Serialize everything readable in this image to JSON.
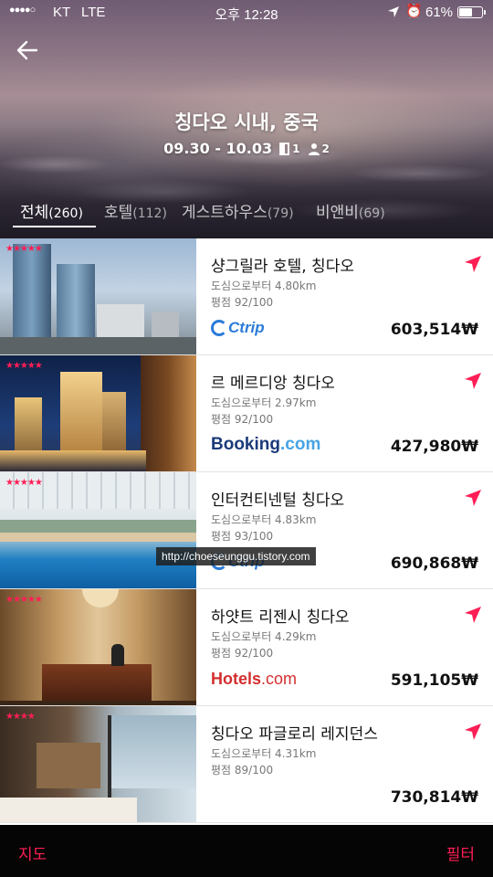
{
  "status_bar": {
    "signal": "●●●●○",
    "carrier": "KT",
    "network": "LTE",
    "time": "오후 12:28",
    "battery": "61%",
    "battery_level": 0.61
  },
  "header": {
    "destination": "칭다오 시내, 중국",
    "dates": "09.30 - 10.03",
    "rooms": "1",
    "guests": "2"
  },
  "tabs": [
    {
      "label": "전체",
      "count": "(260)",
      "active": true
    },
    {
      "label": "호텔",
      "count": "(112)",
      "active": false
    },
    {
      "label": "게스트하우스",
      "count": "(79)",
      "active": false
    },
    {
      "label": "비앤비",
      "count": "(69)",
      "active": false
    }
  ],
  "hotels": [
    {
      "name": "샹그릴라 호텔, 칭다오",
      "stars": "★★★★★",
      "distance": "도심으로부터 4.80km",
      "rating": "평점 92/100",
      "provider": "Ctrip",
      "price": "603,514₩"
    },
    {
      "name": "르 메르디앙 칭다오",
      "stars": "★★★★★",
      "distance": "도심으로부터 2.97km",
      "rating": "평점 92/100",
      "provider": "Booking.com",
      "price": "427,980₩"
    },
    {
      "name": "인터컨티넨털 칭다오",
      "stars": "★★★★★",
      "distance": "도심으로부터 4.83km",
      "rating": "평점 93/100",
      "provider": "Ctrip",
      "price": "690,868₩"
    },
    {
      "name": "하얏트 리젠시 칭다오",
      "stars": "★★★★★",
      "distance": "도심으로부터 4.29km",
      "rating": "평점 92/100",
      "provider": "Hotels.com",
      "price": "591,105₩"
    },
    {
      "name": "칭다오 파글로리 레지던스",
      "stars": "★★★★",
      "distance": "도심으로부터 4.31km",
      "rating": "평점 89/100",
      "provider": "",
      "price": "730,814₩"
    }
  ],
  "providers": {
    "ctrip": "Ctrip",
    "booking_main": "Booking",
    "booking_suffix": ".com",
    "hotels_main": "Hotels",
    "hotels_suffix": ".com"
  },
  "watermark": "http://choeseunggu.tistory.com",
  "bottom_bar": {
    "map": "지도",
    "filter": "필터"
  },
  "colors": {
    "accent": "#ff1e55",
    "ctrip": "#2b7bd8",
    "booking": "#1a3a7a",
    "hotels": "#d32f2f"
  }
}
